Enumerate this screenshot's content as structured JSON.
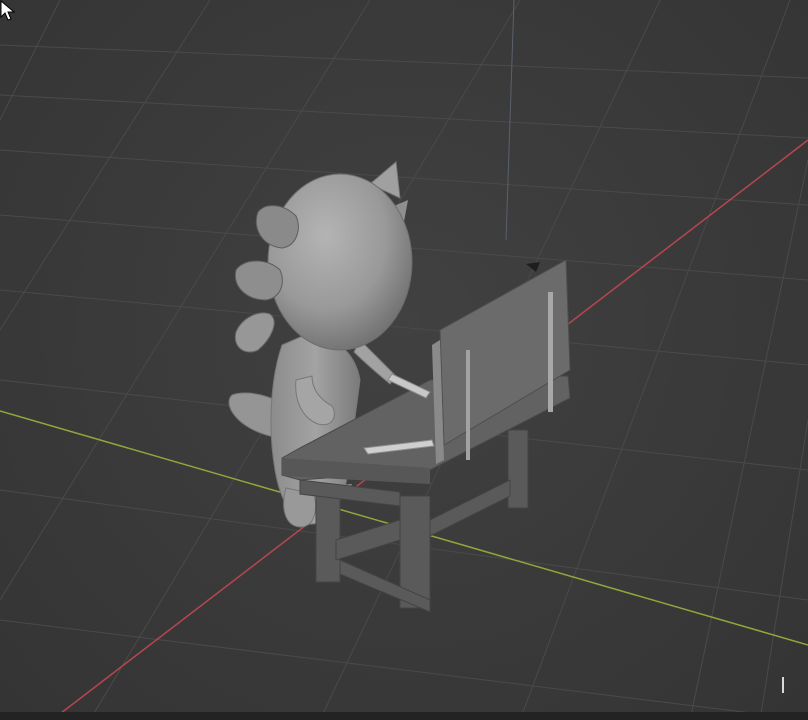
{
  "app": {
    "kind": "3D viewport"
  },
  "viewport": {
    "shading": "solid",
    "grid": true,
    "axes": {
      "x_color": "#b8464f",
      "y_color": "#8ea83b",
      "z_color": "#5f6a78"
    },
    "object_color": "#9a9a9a"
  },
  "icons": {
    "cursor": "arrow-cursor-icon"
  }
}
